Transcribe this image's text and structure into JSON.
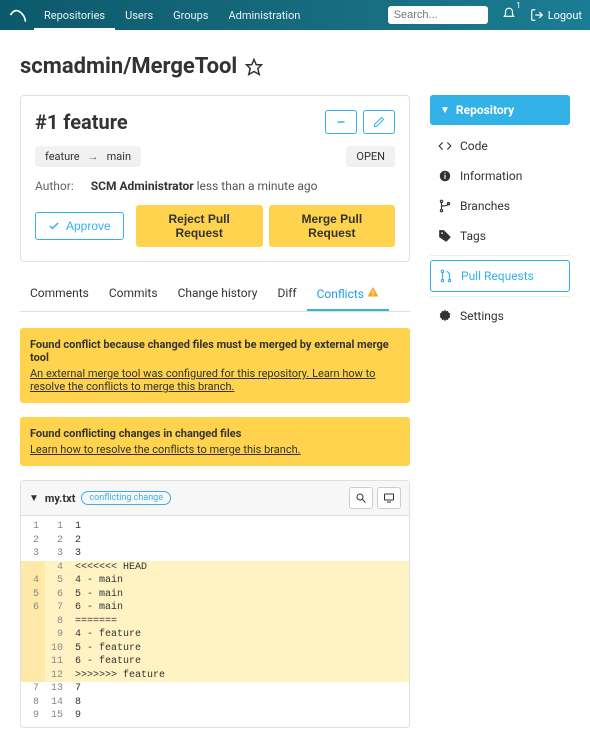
{
  "topbar": {
    "nav": [
      "Repositories",
      "Users",
      "Groups",
      "Administration"
    ],
    "searchPlaceholder": "Search...",
    "notifCount": "1",
    "logout": "Logout"
  },
  "title": "scmadmin/MergeTool",
  "pr": {
    "title": "#1 feature",
    "source": "feature",
    "target": "main",
    "status": "OPEN",
    "authorLabel": "Author:",
    "authorName": "SCM Administrator",
    "time": "less than a minute ago",
    "approve": "Approve",
    "reject": "Reject Pull Request",
    "merge": "Merge Pull Request"
  },
  "tabs": [
    "Comments",
    "Commits",
    "Change history",
    "Diff",
    "Conflicts"
  ],
  "notices": [
    {
      "title": "Found conflict because changed files must be merged by external merge tool",
      "link": "An external merge tool was configured for this repository. Learn how to resolve the conflicts to merge this branch."
    },
    {
      "title": "Found conflicting changes in changed files",
      "link": "Learn how to resolve the conflicts to merge this branch."
    }
  ],
  "file": {
    "name": "my.txt",
    "pill": "conflicting change"
  },
  "diff": [
    {
      "l": "1",
      "r": "1",
      "t": "1",
      "c": false
    },
    {
      "l": "2",
      "r": "2",
      "t": "2",
      "c": false
    },
    {
      "l": "3",
      "r": "3",
      "t": "3",
      "c": false
    },
    {
      "l": "",
      "r": "4",
      "t": "<<<<<<< HEAD",
      "c": true
    },
    {
      "l": "4",
      "r": "5",
      "t": "4 - main",
      "c": true
    },
    {
      "l": "5",
      "r": "6",
      "t": "5 - main",
      "c": true
    },
    {
      "l": "6",
      "r": "7",
      "t": "6 - main",
      "c": true
    },
    {
      "l": "",
      "r": "8",
      "t": "=======",
      "c": true
    },
    {
      "l": "",
      "r": "9",
      "t": "4 - feature",
      "c": true
    },
    {
      "l": "",
      "r": "10",
      "t": "5 - feature",
      "c": true
    },
    {
      "l": "",
      "r": "11",
      "t": "6 - feature",
      "c": true
    },
    {
      "l": "",
      "r": "12",
      "t": ">>>>>>> feature",
      "c": true
    },
    {
      "l": "7",
      "r": "13",
      "t": "7",
      "c": false
    },
    {
      "l": "8",
      "r": "14",
      "t": "8",
      "c": false
    },
    {
      "l": "9",
      "r": "15",
      "t": "9",
      "c": false
    }
  ],
  "sidebar": {
    "header": "Repository",
    "items": [
      "Code",
      "Information",
      "Branches",
      "Tags",
      "Pull Requests",
      "Settings"
    ]
  }
}
